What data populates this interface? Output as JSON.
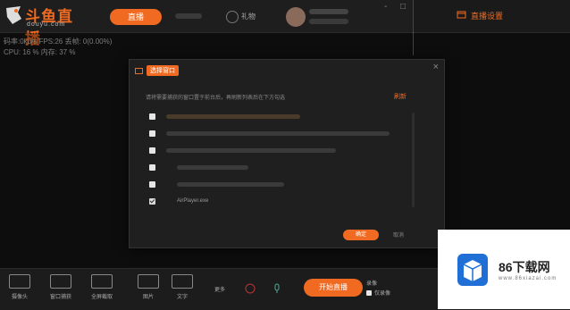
{
  "app": {
    "logo_text": "斗鱼直播",
    "logo_sub": "douyu.com"
  },
  "topbar": {
    "live_pill": "直播",
    "gift_label": "礼物",
    "window_buttons": [
      "-",
      "□"
    ]
  },
  "right_panel": {
    "title": "直播设置"
  },
  "stats": {
    "line1": "码率:0kb/s   FPS:26   丢帧:  0(0.00%)",
    "line2": "CPU: 16 %    内存: 37 %"
  },
  "dialog": {
    "title": "选择窗口",
    "close": "×",
    "description": "请将需要捕获的窗口置于前台后，再刷新列表后在下方勾选",
    "refresh": "刷新",
    "items": [
      {
        "label": "",
        "checked": false
      },
      {
        "label": "",
        "checked": false
      },
      {
        "label": "",
        "checked": false
      },
      {
        "label": "",
        "checked": false
      },
      {
        "label": "",
        "checked": false
      },
      {
        "label": "AirPlayer.exe",
        "checked": true
      }
    ],
    "ok": "确定",
    "cancel": "取消"
  },
  "bottom": {
    "tools": [
      {
        "label": "摄像头",
        "icon": "camera-icon"
      },
      {
        "label": "窗口捕获",
        "icon": "window-icon"
      },
      {
        "label": "全屏截取",
        "icon": "screen-icon"
      },
      {
        "label": "图片",
        "icon": "image-icon"
      },
      {
        "label": "文字",
        "icon": "text-icon"
      }
    ],
    "extra_label": "更多",
    "start_live": "开始直播",
    "options": [
      "录像",
      "仅录像"
    ]
  },
  "ad": {
    "brand": "86下载网",
    "sub": "www.86xiazai.com"
  },
  "colors": {
    "accent": "#f06a21",
    "bg": "#141414"
  }
}
